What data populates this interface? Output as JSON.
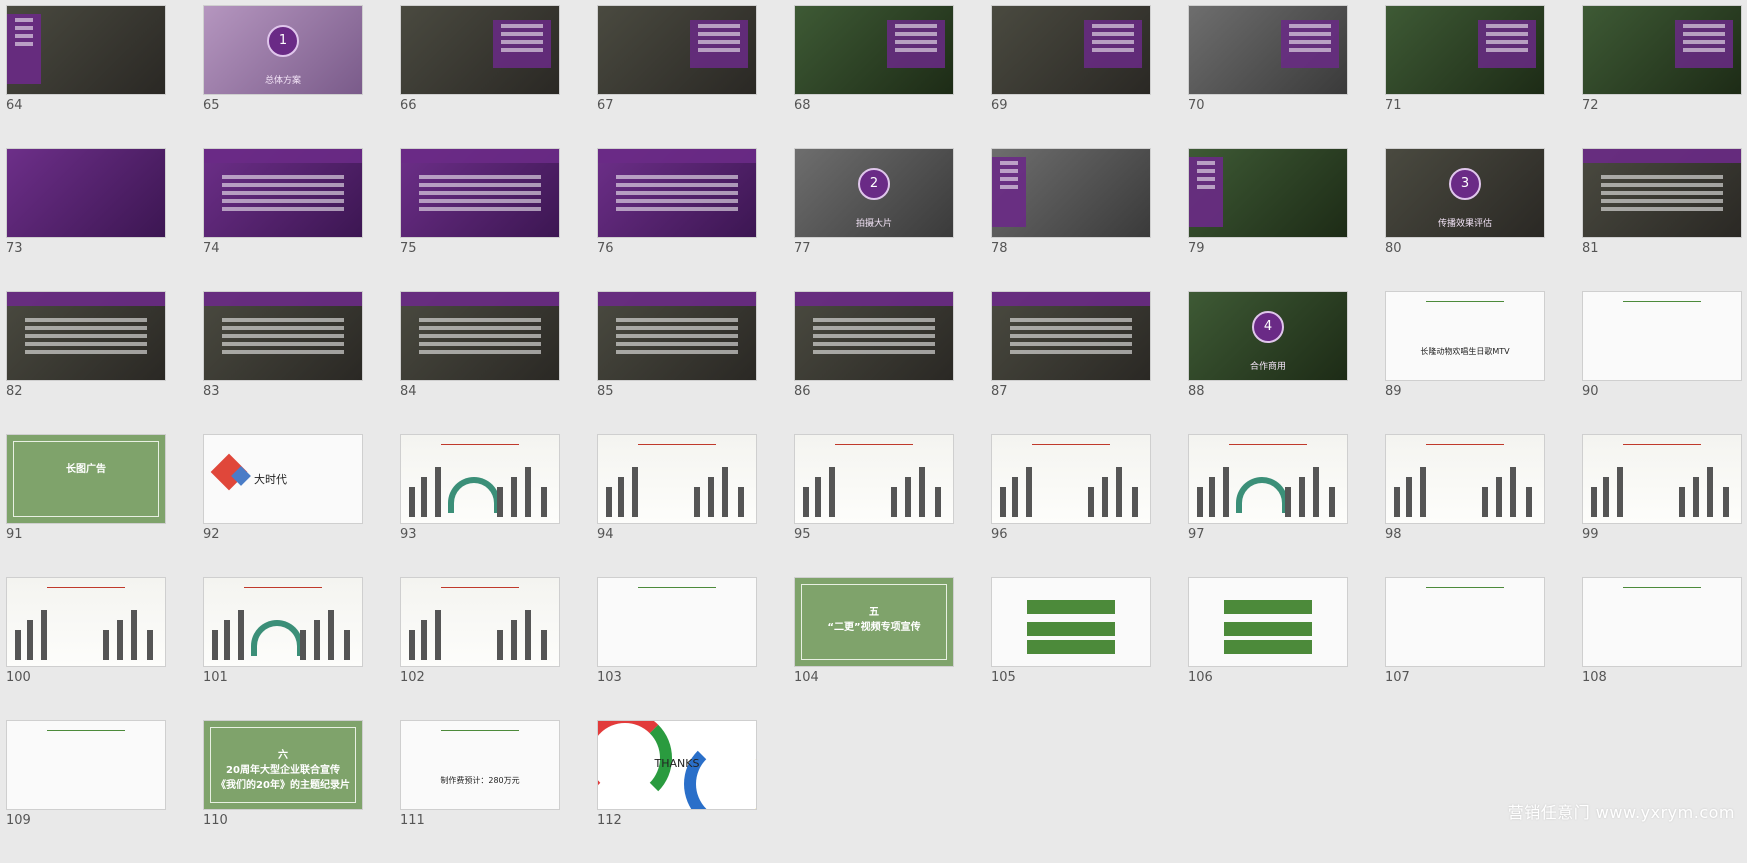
{
  "slides": [
    {
      "num": "64",
      "theme": "dark",
      "kind": "lpanel"
    },
    {
      "num": "65",
      "theme": "tigerpurple",
      "kind": "circle",
      "circle": "1",
      "caption": "总体方案"
    },
    {
      "num": "66",
      "theme": "dark",
      "kind": "panel"
    },
    {
      "num": "67",
      "theme": "dark",
      "kind": "panel"
    },
    {
      "num": "68",
      "theme": "photo",
      "kind": "panel"
    },
    {
      "num": "69",
      "theme": "dark",
      "kind": "panel"
    },
    {
      "num": "70",
      "theme": "gray",
      "kind": "panel"
    },
    {
      "num": "71",
      "theme": "photo",
      "kind": "panel"
    },
    {
      "num": "72",
      "theme": "photo",
      "kind": "panel"
    },
    {
      "num": "73",
      "theme": "purple",
      "kind": "plain"
    },
    {
      "num": "74",
      "theme": "purple",
      "kind": "bars"
    },
    {
      "num": "75",
      "theme": "purple",
      "kind": "bars"
    },
    {
      "num": "76",
      "theme": "purple",
      "kind": "band"
    },
    {
      "num": "77",
      "theme": "gray",
      "kind": "circle",
      "circle": "2",
      "caption": "拍摄大片"
    },
    {
      "num": "78",
      "theme": "gray",
      "kind": "lpanel"
    },
    {
      "num": "79",
      "theme": "photo",
      "kind": "lpanel"
    },
    {
      "num": "80",
      "theme": "dark",
      "kind": "circle",
      "circle": "3",
      "caption": "传播效果评估"
    },
    {
      "num": "81",
      "theme": "dark",
      "kind": "bars"
    },
    {
      "num": "82",
      "theme": "dark",
      "kind": "band"
    },
    {
      "num": "83",
      "theme": "dark",
      "kind": "band"
    },
    {
      "num": "84",
      "theme": "dark",
      "kind": "band"
    },
    {
      "num": "85",
      "theme": "dark",
      "kind": "band"
    },
    {
      "num": "86",
      "theme": "dark",
      "kind": "band"
    },
    {
      "num": "87",
      "theme": "dark",
      "kind": "band"
    },
    {
      "num": "88",
      "theme": "photo",
      "kind": "circle",
      "circle": "4",
      "caption": "合作商用"
    },
    {
      "num": "89",
      "theme": "white",
      "kind": "text",
      "text": "长隆动物欢唱生日歌MTV"
    },
    {
      "num": "90",
      "theme": "white",
      "kind": "topbar"
    },
    {
      "num": "91",
      "theme": "green",
      "kind": "greenframe",
      "title": "长图广告"
    },
    {
      "num": "92",
      "theme": "white",
      "kind": "diamond",
      "text": "大时代"
    },
    {
      "num": "93",
      "theme": "people",
      "kind": "arch"
    },
    {
      "num": "94",
      "theme": "people",
      "kind": "people"
    },
    {
      "num": "95",
      "theme": "people",
      "kind": "people"
    },
    {
      "num": "96",
      "theme": "people",
      "kind": "people"
    },
    {
      "num": "97",
      "theme": "people",
      "kind": "arch"
    },
    {
      "num": "98",
      "theme": "people",
      "kind": "people"
    },
    {
      "num": "99",
      "theme": "people",
      "kind": "people"
    },
    {
      "num": "100",
      "theme": "people",
      "kind": "people"
    },
    {
      "num": "101",
      "theme": "people",
      "kind": "arch"
    },
    {
      "num": "102",
      "theme": "people",
      "kind": "people"
    },
    {
      "num": "103",
      "theme": "white",
      "kind": "topbar"
    },
    {
      "num": "104",
      "theme": "green",
      "kind": "greenframe",
      "title": "五\n“二更”视频专项宣传"
    },
    {
      "num": "105",
      "theme": "white",
      "kind": "gbtns"
    },
    {
      "num": "106",
      "theme": "white",
      "kind": "gbtns"
    },
    {
      "num": "107",
      "theme": "white",
      "kind": "topbar"
    },
    {
      "num": "108",
      "theme": "white",
      "kind": "topbar"
    },
    {
      "num": "109",
      "theme": "white",
      "kind": "topbar"
    },
    {
      "num": "110",
      "theme": "green",
      "kind": "greenframe",
      "title": "六\n20周年大型企业联合宣传\n《我们的20年》的主题纪录片"
    },
    {
      "num": "111",
      "theme": "white",
      "kind": "text",
      "text": "制作费预计：280万元"
    },
    {
      "num": "112",
      "theme": "thanks",
      "kind": "thanks",
      "text": "THANKS"
    }
  ],
  "watermark": "营销任意门 www.yxrym.com"
}
